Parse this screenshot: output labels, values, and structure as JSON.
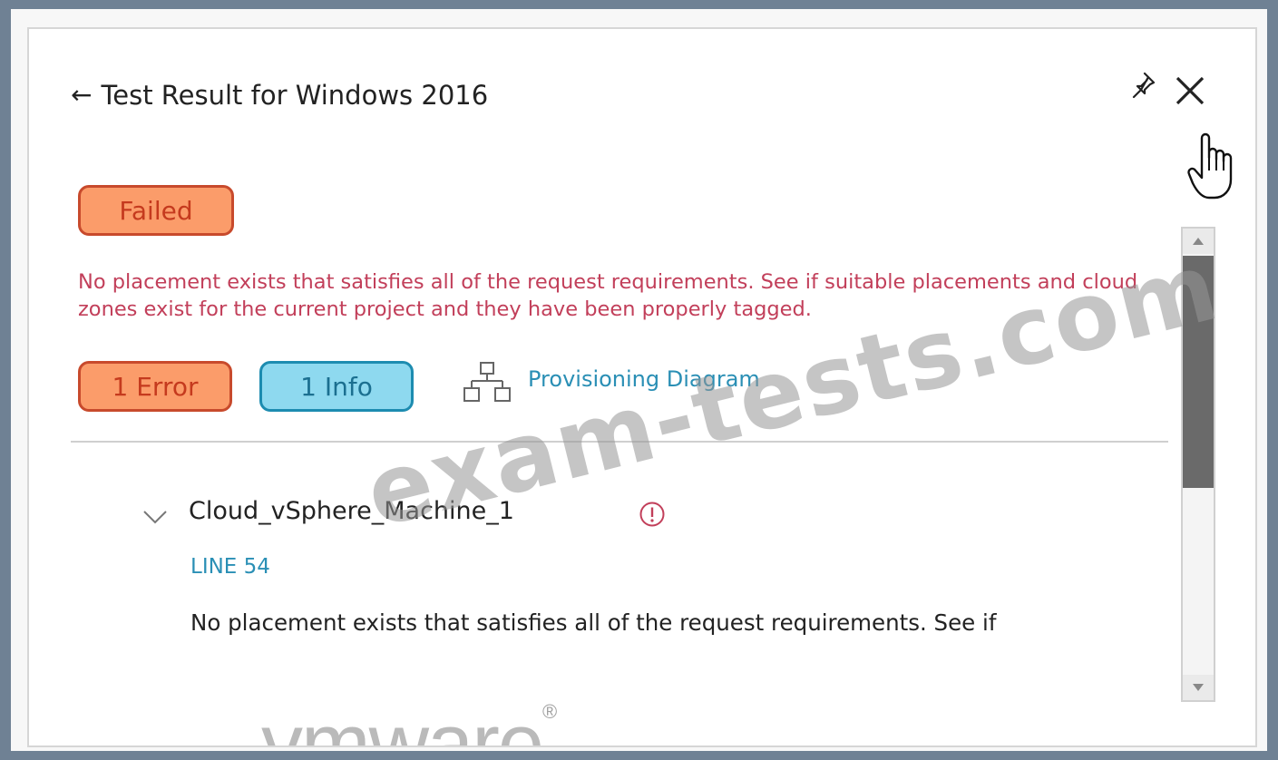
{
  "header": {
    "back_icon": "arrow-left-icon",
    "title": "Test Result for Windows 2016",
    "pin_icon": "pin-icon",
    "close_icon": "close-icon"
  },
  "status": {
    "label": "Failed",
    "message": "No placement exists that satisfies all of the request requirements. See if suitable placements and cloud zones exist for the current project and they have been properly tagged."
  },
  "counts": {
    "error_label": "1 Error",
    "info_label": "1 Info"
  },
  "diagram_link": {
    "label": "Provisioning Diagram",
    "icon": "diagram-icon"
  },
  "result_item": {
    "name": "Cloud_vSphere_Machine_1",
    "line": "LINE 54",
    "detail": "No placement exists that satisfies all of the request requirements. See if",
    "status_icon": "alert-circle-icon"
  },
  "watermark": "exam-tests.com",
  "logo": {
    "text": "vmware",
    "reg": "®"
  },
  "colors": {
    "error_fill": "#fb9c6a",
    "error_border": "#c84a2c",
    "info_fill": "#8ed9ef",
    "info_border": "#1d8cb0",
    "message_text": "#c23f5a",
    "link": "#2a8fb5"
  }
}
